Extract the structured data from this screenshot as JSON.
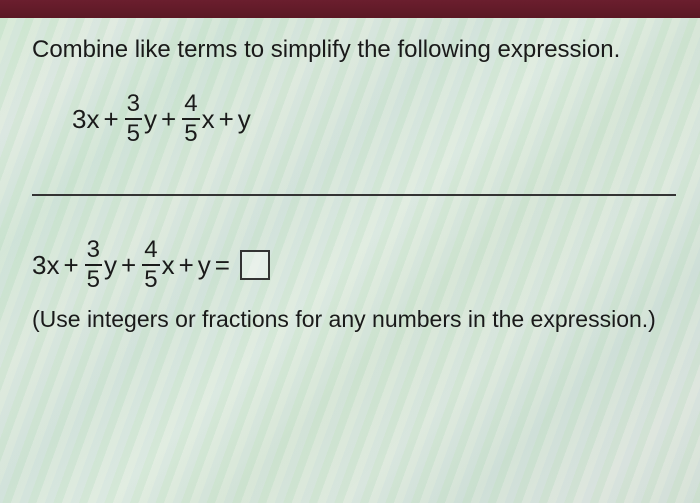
{
  "prompt": "Combine like terms to simplify the following expression.",
  "expression": {
    "t1": "3x",
    "op1": "+",
    "f1_num": "3",
    "f1_den": "5",
    "t2": "y",
    "op2": "+",
    "f2_num": "4",
    "f2_den": "5",
    "t3": "x",
    "op3": "+",
    "t4": "y"
  },
  "answer_line": {
    "t1": "3x",
    "op1": "+",
    "f1_num": "3",
    "f1_den": "5",
    "t2": "y",
    "op2": "+",
    "f2_num": "4",
    "f2_den": "5",
    "t3": "x",
    "op3": "+",
    "t4": "y",
    "eq": "="
  },
  "hint": "(Use integers or fractions for any numbers in the expression.)"
}
